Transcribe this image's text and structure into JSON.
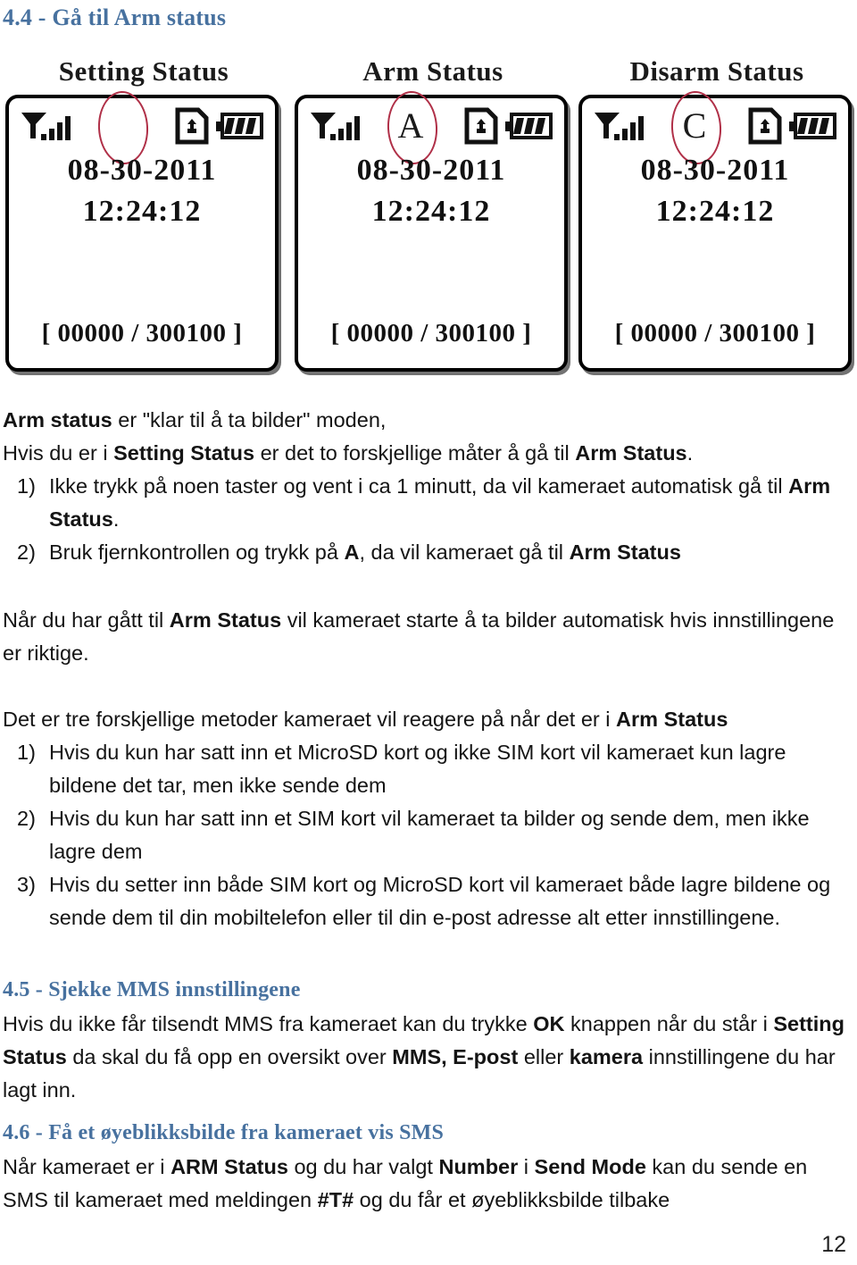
{
  "headings": {
    "h44": "4.4 - Gå til Arm status",
    "h45": "4.5 - Sjekke MMS innstillingene",
    "h46": "4.6 - Få et øyeblikksbilde fra kameraet vis SMS"
  },
  "figure": {
    "screens": [
      {
        "title": "Setting Status",
        "center_glyph": "",
        "date": "08-30-2011",
        "time": "12:24:12",
        "counter": "[ 00000 / 300100 ]",
        "icons": [
          "antenna-signal-icon",
          "sd-card-icon",
          "battery-icon"
        ],
        "annotation": "red-circle-highlight"
      },
      {
        "title": "Arm Status",
        "center_glyph": "A",
        "date": "08-30-2011",
        "time": "12:24:12",
        "counter": "[ 00000 / 300100 ]",
        "icons": [
          "antenna-signal-icon",
          "sd-card-icon",
          "battery-icon"
        ],
        "annotation": "red-circle-highlight"
      },
      {
        "title": "Disarm Status",
        "center_glyph": "C",
        "date": "08-30-2011",
        "time": "12:24:12",
        "counter": "[ 00000 / 300100 ]",
        "icons": [
          "antenna-signal-icon",
          "sd-card-icon",
          "battery-icon"
        ],
        "annotation": "red-circle-highlight"
      }
    ]
  },
  "section_44": {
    "line1_bold": "Arm status",
    "line1_rest": " er \"klar til å ta bilder\" moden,",
    "line2_a": "Hvis du er i ",
    "line2_b1": "Setting Status",
    "line2_c": " er det to forskjellige måter å gå til ",
    "line2_b2": "Arm Status",
    "line2_d": ".",
    "item1_num": "1)",
    "item1_text": "Ikke trykk på noen taster og vent i ca 1 minutt, da vil kameraet automatisk gå til ",
    "item1_bold": "Arm Status",
    "item1_tail": ".",
    "item2_num": "2)",
    "item2_a": "Bruk fjernkontrollen og trykk på ",
    "item2_b1": "A",
    "item2_c": ", da vil kameraet gå til ",
    "item2_b2": "Arm Status",
    "para3_a": "Når du har gått til ",
    "para3_b": "Arm Status",
    "para3_c": " vil kameraet starte å ta bilder automatisk hvis innstillingene er riktige.",
    "para4_a": "Det er tre forskjellige metoder kameraet vil reagere på når det er i ",
    "para4_b": "Arm Status",
    "m1_num": "1)",
    "m1_text": "Hvis du kun har satt inn et MicroSD kort og ikke SIM kort vil kameraet kun lagre bildene det tar, men ikke sende dem",
    "m2_num": "2)",
    "m2_text": "Hvis du kun har satt inn et SIM kort vil kameraet ta bilder og sende dem, men ikke lagre dem",
    "m3_num": "3)",
    "m3_text": "Hvis du setter inn både SIM kort og MicroSD kort vil kameraet både lagre bildene og sende dem til din mobiltelefon eller til din e-post adresse alt etter innstillingene."
  },
  "section_45": {
    "a": "Hvis du ikke får tilsendt MMS fra kameraet kan du trykke ",
    "b1": "OK",
    "c": " knappen når du står i ",
    "b2": "Setting Status",
    "d": " da skal du få opp en oversikt over ",
    "b3": "MMS, E-post",
    "e": " eller ",
    "b4": "kamera",
    "f": " innstillingene du har lagt inn."
  },
  "section_46": {
    "a": "Når kameraet er i ",
    "b1": "ARM Status",
    "c": " og du har valgt ",
    "b2": "Number",
    "d": " i ",
    "b3": "Send Mode",
    "e": " kan du sende en SMS til kameraet med meldingen ",
    "b4": "#T#",
    "f": " og du får et øyeblikksbilde tilbake"
  },
  "footer": {
    "page_number": "12"
  },
  "colors": {
    "heading_blue": "#47719f",
    "annotation_red": "#b03048",
    "text_black": "#141414"
  }
}
